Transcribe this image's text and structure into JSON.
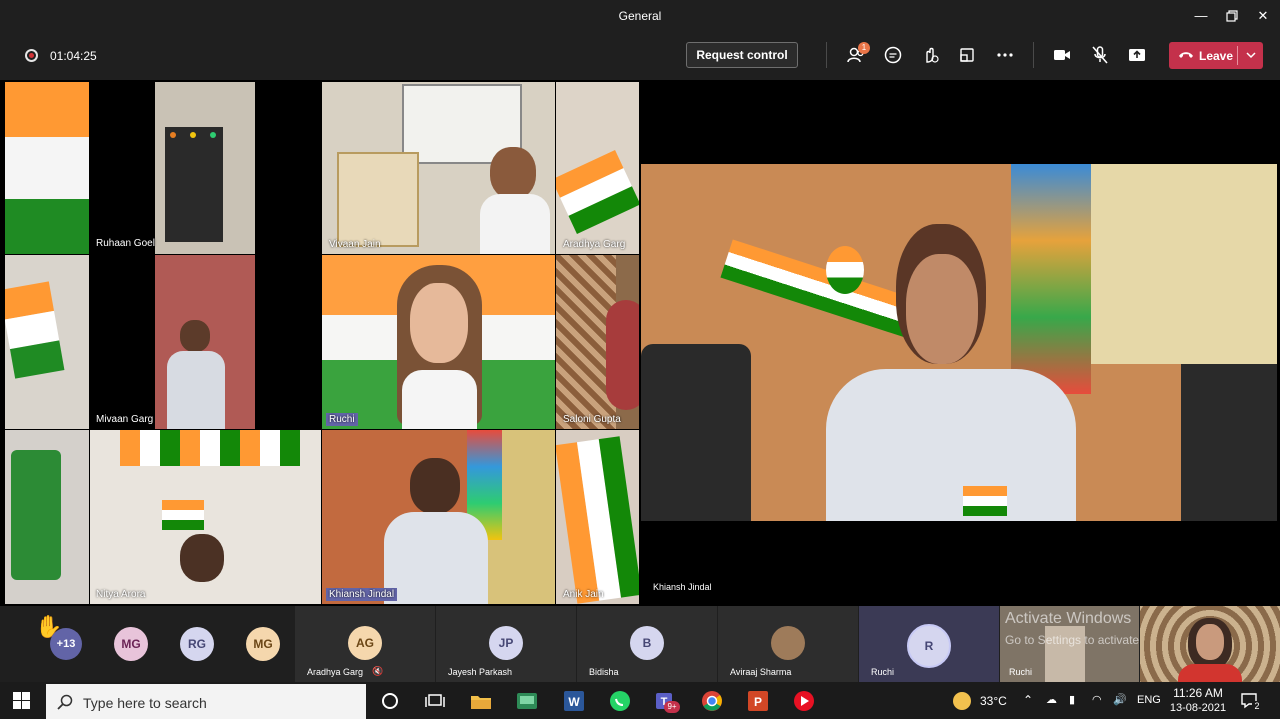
{
  "window": {
    "title": "General"
  },
  "toolbar": {
    "timer": "01:04:25",
    "request_control": "Request control",
    "participants_badge": "1",
    "leave_label": "Leave"
  },
  "grid_tiles": [
    {
      "name": "Ruhaan  Goel"
    },
    {
      "name": "Vivaan Jain"
    },
    {
      "name": "Aradhya Garg"
    },
    {
      "name": "Mivaan  Garg"
    },
    {
      "name": "Ruchi"
    },
    {
      "name": "Saloni Gupta"
    },
    {
      "name": "Nitya Arora"
    },
    {
      "name": "Khiansh  Jindal"
    },
    {
      "name": "Anik  Jain"
    }
  ],
  "main_video": {
    "name": "Khiansh Jindal"
  },
  "strip": {
    "raised_count": "+13",
    "avatars": [
      {
        "initials": "MG",
        "bg": "#e8c4da",
        "fg": "#6b2456"
      },
      {
        "initials": "RG",
        "bg": "#d5d6ef",
        "fg": "#464775"
      },
      {
        "initials": "MG",
        "bg": "#f5d7ad",
        "fg": "#6b4616"
      }
    ],
    "participants": [
      {
        "initials": "AG",
        "name": "Aradhya Garg"
      },
      {
        "initials": "JP",
        "name": "Jayesh Parkash"
      },
      {
        "initials": "B",
        "name": "Bidisha"
      },
      {
        "initials": "",
        "name": "Aviraaj Sharma"
      },
      {
        "initials": "R",
        "name": "Ruchi"
      }
    ],
    "thumb_name": "Ruchi",
    "activate_title": "Activate Windows",
    "activate_sub": "Go to Settings to activate"
  },
  "taskbar": {
    "search_placeholder": "Type here to search",
    "teams_badge": "9+",
    "temperature": "33°C",
    "language": "ENG",
    "time": "11:26 AM",
    "date": "13-08-2021",
    "notifications": "2"
  },
  "colors": {
    "accent": "#6264a7",
    "leave": "#c4314b",
    "saffron": "#ff9933",
    "india_green": "#138808"
  }
}
